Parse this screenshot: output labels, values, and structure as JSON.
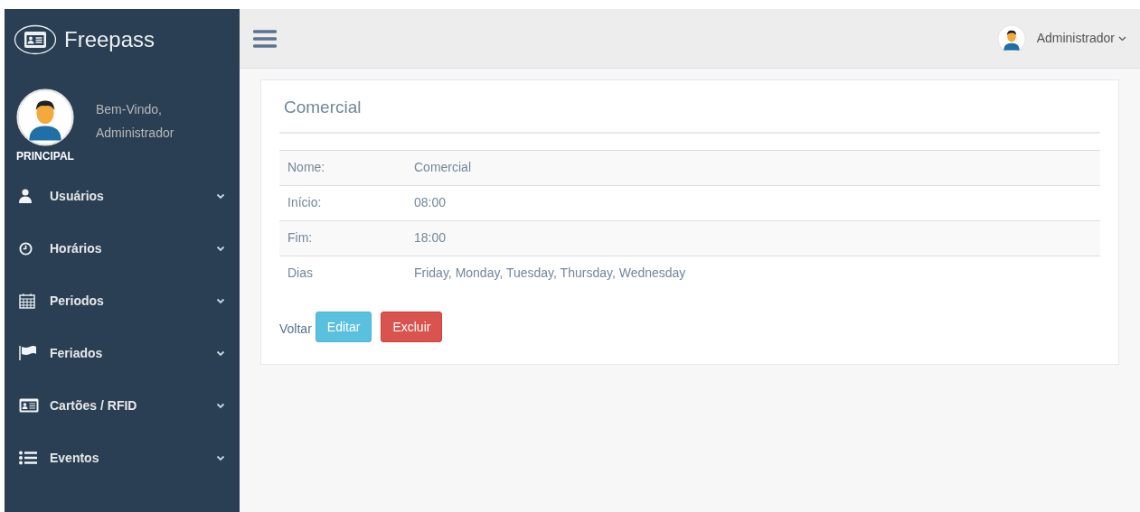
{
  "sidebar": {
    "brand": "Freepass",
    "welcome": "Bem-Vindo,",
    "user": "Administrador",
    "section": "PRINCIPAL",
    "items": [
      {
        "label": "Usuários"
      },
      {
        "label": "Horários"
      },
      {
        "label": "Periodos"
      },
      {
        "label": "Feriados"
      },
      {
        "label": "Cartões / RFID"
      },
      {
        "label": "Eventos"
      }
    ]
  },
  "topbar": {
    "user": "Administrador"
  },
  "panel": {
    "title": "Comercial",
    "rows": [
      {
        "label": "Nome:",
        "value": "Comercial"
      },
      {
        "label": "Início:",
        "value": "08:00"
      },
      {
        "label": "Fim:",
        "value": "18:00"
      },
      {
        "label": "Dias",
        "value": "Friday, Monday, Tuesday, Thursday, Wednesday"
      }
    ],
    "back": "Voltar",
    "edit": "Editar",
    "delete": "Excluir"
  }
}
